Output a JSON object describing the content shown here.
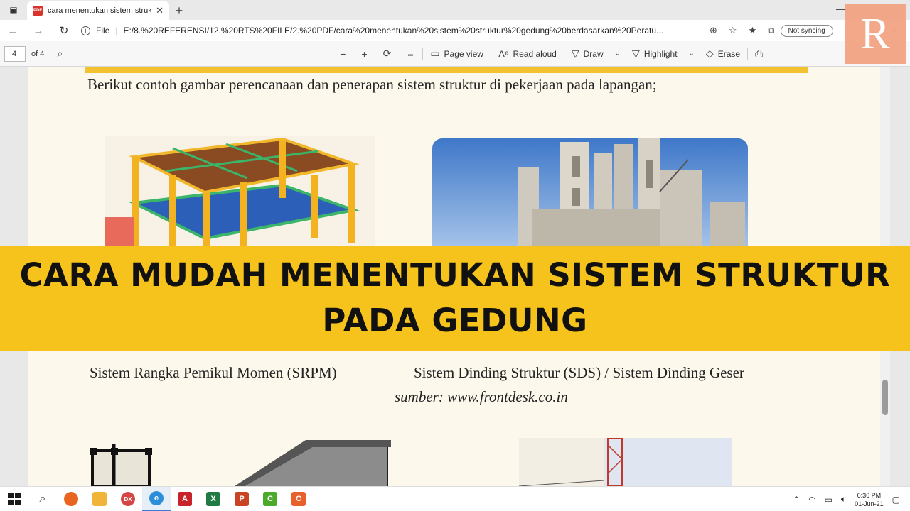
{
  "browser": {
    "tab_title": "cara menentukan sistem struktur",
    "tab_close": "✕",
    "new_tab": "+",
    "minimize": "—",
    "address_scheme": "File",
    "url": "E:/8.%20REFERENSI/12.%20RTS%20FILE/2.%20PDF/cara%20menentukan%20sistem%20struktur%20gedung%20berdasarkan%20Peratu...",
    "sync_label": "Not syncing",
    "more": "⋯"
  },
  "pdf_toolbar": {
    "page_current": "4",
    "page_total": "of 4",
    "zoom_out": "−",
    "zoom_in": "+",
    "page_view": "Page view",
    "read_aloud": "Read aloud",
    "draw": "Draw",
    "highlight": "Highlight",
    "erase": "Erase"
  },
  "logo": {
    "letter": "R"
  },
  "document": {
    "intro": "Berikut contoh gambar perencanaan dan penerapan sistem struktur di pekerjaan pada lapangan;",
    "caption_left": "Sistem Rangka Pemikul Momen  (SRPM)",
    "caption_right": "Sistem Dinding Struktur (SDS) / Sistem Dinding Geser",
    "source": "sumber: www.frontdesk.co.in"
  },
  "banner": {
    "line1": "CARA MUDAH MENENTUKAN SISTEM STRUKTUR",
    "line2": "PADA GEDUNG"
  },
  "taskbar": {
    "apps": [
      {
        "name": "start",
        "label": "",
        "color": "#1a6fd6"
      },
      {
        "name": "search",
        "label": "",
        "color": "#333333"
      },
      {
        "name": "firefox",
        "label": "",
        "color": "#e8661f"
      },
      {
        "name": "explorer",
        "label": "",
        "color": "#f0b43a"
      },
      {
        "name": "dx",
        "label": "DX",
        "color": "#d64545"
      },
      {
        "name": "edge",
        "label": "e",
        "color": "#2a8fd8"
      },
      {
        "name": "autocad",
        "label": "A",
        "color": "#c8222b"
      },
      {
        "name": "excel",
        "label": "X",
        "color": "#1f7a43"
      },
      {
        "name": "powerpoint",
        "label": "P",
        "color": "#c94422"
      },
      {
        "name": "camtasia-green",
        "label": "C",
        "color": "#4caa2b"
      },
      {
        "name": "camtasia-orange",
        "label": "C",
        "color": "#e8612c"
      }
    ],
    "time": "6:36 PM",
    "date": "01-Jun-21"
  }
}
